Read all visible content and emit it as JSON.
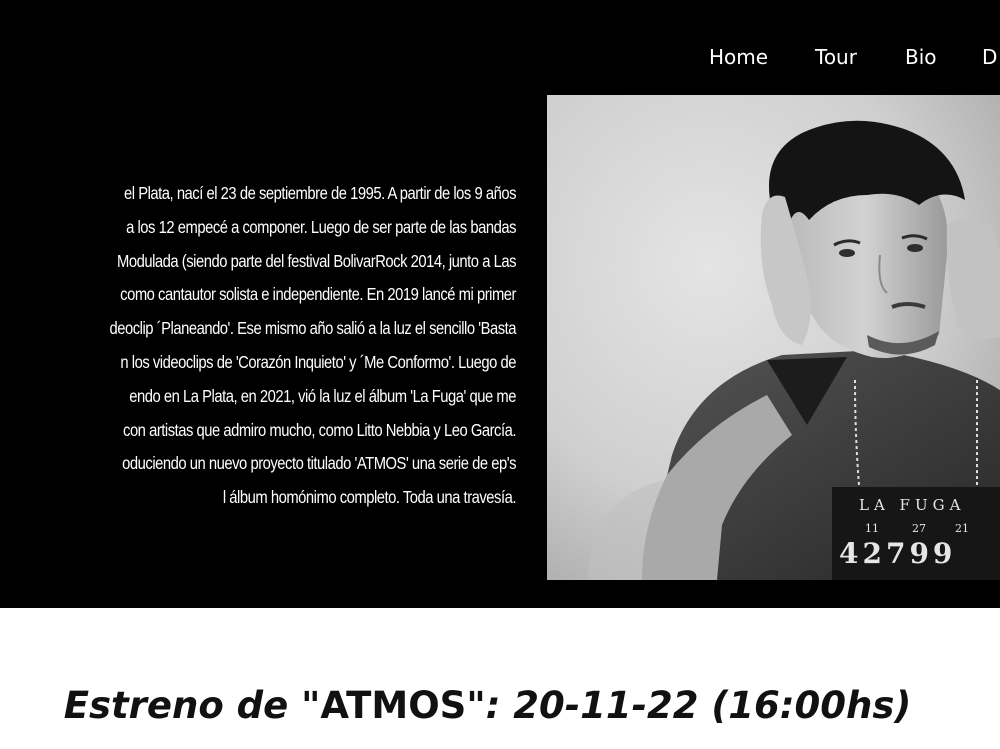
{
  "nav": {
    "items": [
      {
        "label": "Home"
      },
      {
        "label": "Tour"
      },
      {
        "label": "Bio"
      },
      {
        "label": "D"
      }
    ]
  },
  "bio": {
    "lines": [
      "el Plata, nací el 23 de septiembre de 1995. A partir de los 9 años",
      "a los 12 empecé a componer. Luego de ser parte de las bandas",
      "Modulada (siendo parte del festival BolivarRock 2014, junto a Las",
      "como cantautor solista e independiente. En 2019 lancé mi primer",
      "deoclip ´Planeando'. Ese mismo año salió a la luz el sencillo 'Basta",
      "n los videoclips de 'Corazón Inquieto' y ´Me Conformo'. Luego de",
      "endo en La Plata, en 2021, vió la luz el álbum 'La Fuga' que me",
      "con artistas que admiro mucho, como Litto Nebbia y Leo García.",
      "oduciendo un nuevo proyecto titulado 'ATMOS' una serie de ep's",
      "l álbum homónimo completo. Toda una travesía."
    ]
  },
  "photo": {
    "board_title": "LA FUGA",
    "board_date": [
      "11",
      "27",
      "21"
    ],
    "board_number": "42799"
  },
  "release": {
    "prefix": "Estreno de ",
    "title": "\"ATMOS\"",
    "suffix": ": 20-11-22 (16:00hs)"
  },
  "colors": {
    "hero_bg": "#000000",
    "text_light": "#ffffff",
    "text_dark": "#111111"
  }
}
